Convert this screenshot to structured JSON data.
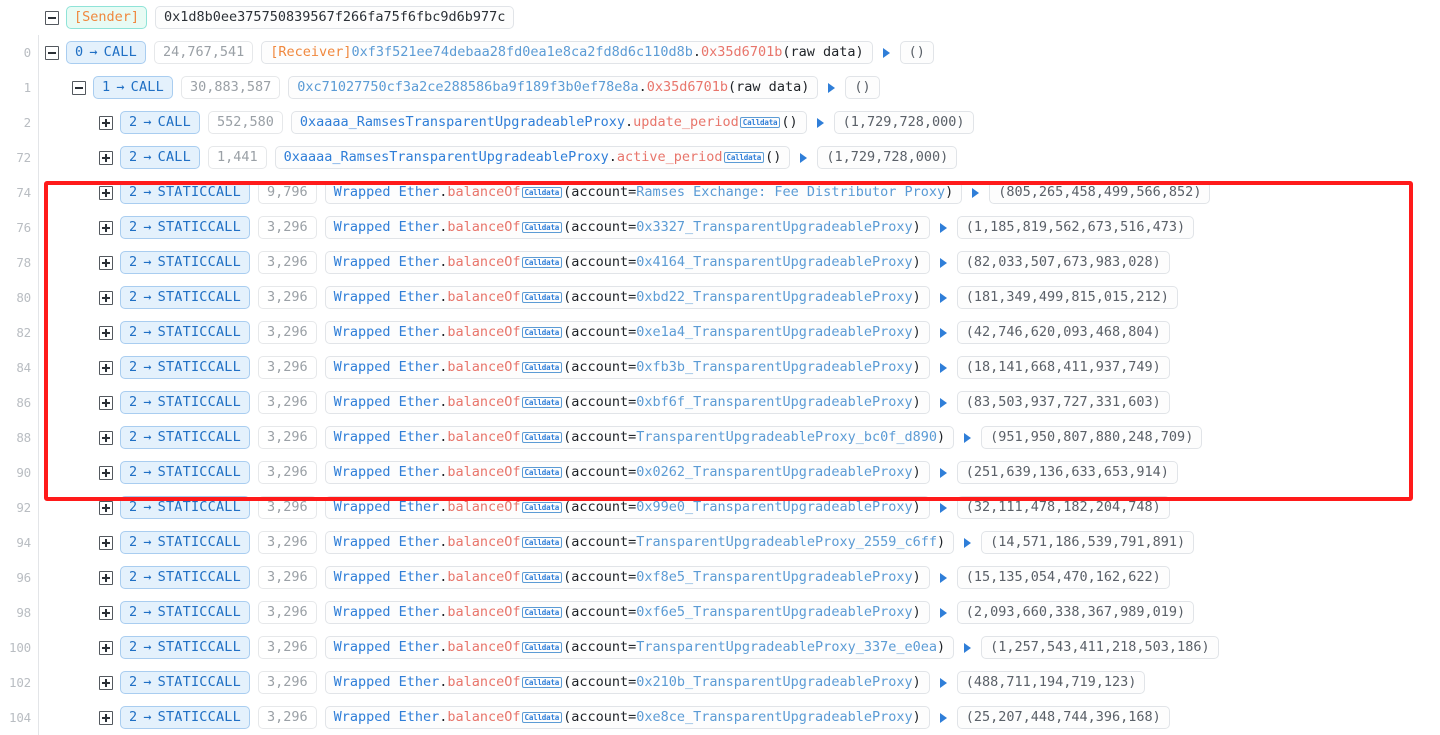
{
  "meta": {
    "accent_blue": "#2f7ed8",
    "accent_orange": "#f0883e",
    "accent_red": "#e8756b",
    "highlight_color": "#ff1a1a",
    "calldata_badge": "Calldata"
  },
  "sender_row": {
    "label": "[Sender]",
    "address": "0x1d8b0ee375750839567f266fa75f6fbc9d6b977c"
  },
  "rows": [
    {
      "line": "0",
      "indent": 0,
      "toggle": "minus",
      "op_index": "0",
      "op_type": "CALL",
      "gas": "24,767,541",
      "call": {
        "prefix_label": "[Receiver]",
        "target": "0xf3f521ee74debaa28fd0ea1e8ca2fd8d6c110d8b",
        "selector": "0x35d6701b",
        "args": "(raw data)"
      },
      "return_value": "()"
    },
    {
      "line": "1",
      "indent": 1,
      "toggle": "minus",
      "op_index": "1",
      "op_type": "CALL",
      "gas": "30,883,587",
      "call": {
        "prefix_label": "",
        "target": "0xc71027750cf3a2ce288586ba9f189f3b0ef78e8a",
        "selector": "0x35d6701b",
        "args": "(raw data)"
      },
      "return_value": "()"
    },
    {
      "line": "2",
      "indent": 2,
      "toggle": "plus",
      "op_index": "2",
      "op_type": "CALL",
      "gas": "552,580",
      "call": {
        "contract": "0xaaaa_RamsesTransparentUpgradeableProxy",
        "method": "update_period",
        "badge": "Calldata",
        "args": "()"
      },
      "return_value": "(1,729,728,000)"
    },
    {
      "line": "72",
      "indent": 2,
      "toggle": "plus",
      "op_index": "2",
      "op_type": "CALL",
      "gas": "1,441",
      "call": {
        "contract": "0xaaaa_RamsesTransparentUpgradeableProxy",
        "method": "active_period",
        "badge": "Calldata",
        "args": "()"
      },
      "return_value": "(1,729,728,000)"
    },
    {
      "line": "74",
      "indent": 2,
      "toggle": "plus",
      "op_index": "2",
      "op_type": "STATICCALL",
      "gas": "9,796",
      "call": {
        "contract": "Wrapped Ether",
        "method": "balanceOf",
        "badge": "Calldata",
        "arg_name": "account=",
        "arg_value": "Ramses Exchange: Fee Distributor Proxy"
      },
      "return_value": "(805,265,458,499,566,852)"
    },
    {
      "line": "76",
      "indent": 2,
      "toggle": "plus",
      "op_index": "2",
      "op_type": "STATICCALL",
      "gas": "3,296",
      "call": {
        "contract": "Wrapped Ether",
        "method": "balanceOf",
        "badge": "Calldata",
        "arg_name": "account=",
        "arg_value": "0x3327_TransparentUpgradeableProxy"
      },
      "return_value": "(1,185,819,562,673,516,473)"
    },
    {
      "line": "78",
      "indent": 2,
      "toggle": "plus",
      "op_index": "2",
      "op_type": "STATICCALL",
      "gas": "3,296",
      "call": {
        "contract": "Wrapped Ether",
        "method": "balanceOf",
        "badge": "Calldata",
        "arg_name": "account=",
        "arg_value": "0x4164_TransparentUpgradeableProxy"
      },
      "return_value": "(82,033,507,673,983,028)"
    },
    {
      "line": "80",
      "indent": 2,
      "toggle": "plus",
      "op_index": "2",
      "op_type": "STATICCALL",
      "gas": "3,296",
      "call": {
        "contract": "Wrapped Ether",
        "method": "balanceOf",
        "badge": "Calldata",
        "arg_name": "account=",
        "arg_value": "0xbd22_TransparentUpgradeableProxy"
      },
      "return_value": "(181,349,499,815,015,212)"
    },
    {
      "line": "82",
      "indent": 2,
      "toggle": "plus",
      "op_index": "2",
      "op_type": "STATICCALL",
      "gas": "3,296",
      "call": {
        "contract": "Wrapped Ether",
        "method": "balanceOf",
        "badge": "Calldata",
        "arg_name": "account=",
        "arg_value": "0xe1a4_TransparentUpgradeableProxy"
      },
      "return_value": "(42,746,620,093,468,804)"
    },
    {
      "line": "84",
      "indent": 2,
      "toggle": "plus",
      "op_index": "2",
      "op_type": "STATICCALL",
      "gas": "3,296",
      "call": {
        "contract": "Wrapped Ether",
        "method": "balanceOf",
        "badge": "Calldata",
        "arg_name": "account=",
        "arg_value": "0xfb3b_TransparentUpgradeableProxy"
      },
      "return_value": "(18,141,668,411,937,749)"
    },
    {
      "line": "86",
      "indent": 2,
      "toggle": "plus",
      "op_index": "2",
      "op_type": "STATICCALL",
      "gas": "3,296",
      "call": {
        "contract": "Wrapped Ether",
        "method": "balanceOf",
        "badge": "Calldata",
        "arg_name": "account=",
        "arg_value": "0xbf6f_TransparentUpgradeableProxy"
      },
      "return_value": "(83,503,937,727,331,603)"
    },
    {
      "line": "88",
      "indent": 2,
      "toggle": "plus",
      "op_index": "2",
      "op_type": "STATICCALL",
      "gas": "3,296",
      "call": {
        "contract": "Wrapped Ether",
        "method": "balanceOf",
        "badge": "Calldata",
        "arg_name": "account=",
        "arg_value": "TransparentUpgradeableProxy_bc0f_d890"
      },
      "return_value": "(951,950,807,880,248,709)"
    },
    {
      "line": "90",
      "indent": 2,
      "toggle": "plus",
      "op_index": "2",
      "op_type": "STATICCALL",
      "gas": "3,296",
      "call": {
        "contract": "Wrapped Ether",
        "method": "balanceOf",
        "badge": "Calldata",
        "arg_name": "account=",
        "arg_value": "0x0262_TransparentUpgradeableProxy"
      },
      "return_value": "(251,639,136,633,653,914)"
    },
    {
      "line": "92",
      "indent": 2,
      "toggle": "plus",
      "op_index": "2",
      "op_type": "STATICCALL",
      "gas": "3,296",
      "call": {
        "contract": "Wrapped Ether",
        "method": "balanceOf",
        "badge": "Calldata",
        "arg_name": "account=",
        "arg_value": "0x99e0_TransparentUpgradeableProxy"
      },
      "return_value": "(32,111,478,182,204,748)"
    },
    {
      "line": "94",
      "indent": 2,
      "toggle": "plus",
      "op_index": "2",
      "op_type": "STATICCALL",
      "gas": "3,296",
      "call": {
        "contract": "Wrapped Ether",
        "method": "balanceOf",
        "badge": "Calldata",
        "arg_name": "account=",
        "arg_value": "TransparentUpgradeableProxy_2559_c6ff"
      },
      "return_value": "(14,571,186,539,791,891)"
    },
    {
      "line": "96",
      "indent": 2,
      "toggle": "plus",
      "op_index": "2",
      "op_type": "STATICCALL",
      "gas": "3,296",
      "call": {
        "contract": "Wrapped Ether",
        "method": "balanceOf",
        "badge": "Calldata",
        "arg_name": "account=",
        "arg_value": "0xf8e5_TransparentUpgradeableProxy"
      },
      "return_value": "(15,135,054,470,162,622)"
    },
    {
      "line": "98",
      "indent": 2,
      "toggle": "plus",
      "op_index": "2",
      "op_type": "STATICCALL",
      "gas": "3,296",
      "call": {
        "contract": "Wrapped Ether",
        "method": "balanceOf",
        "badge": "Calldata",
        "arg_name": "account=",
        "arg_value": "0xf6e5_TransparentUpgradeableProxy"
      },
      "return_value": "(2,093,660,338,367,989,019)"
    },
    {
      "line": "100",
      "indent": 2,
      "toggle": "plus",
      "op_index": "2",
      "op_type": "STATICCALL",
      "gas": "3,296",
      "call": {
        "contract": "Wrapped Ether",
        "method": "balanceOf",
        "badge": "Calldata",
        "arg_name": "account=",
        "arg_value": "TransparentUpgradeableProxy_337e_e0ea"
      },
      "return_value": "(1,257,543,411,218,503,186)"
    },
    {
      "line": "102",
      "indent": 2,
      "toggle": "plus",
      "op_index": "2",
      "op_type": "STATICCALL",
      "gas": "3,296",
      "call": {
        "contract": "Wrapped Ether",
        "method": "balanceOf",
        "badge": "Calldata",
        "arg_name": "account=",
        "arg_value": "0x210b_TransparentUpgradeableProxy"
      },
      "return_value": "(488,711,194,719,123)"
    },
    {
      "line": "104",
      "indent": 2,
      "toggle": "plus",
      "op_index": "2",
      "op_type": "STATICCALL",
      "gas": "3,296",
      "call": {
        "contract": "Wrapped Ether",
        "method": "balanceOf",
        "badge": "Calldata",
        "arg_name": "account=",
        "arg_value": "0xe8ce_TransparentUpgradeableProxy"
      },
      "return_value": "(25,207,448,744,396,168)"
    }
  ],
  "highlight": {
    "first_line": "74",
    "last_line": "90"
  }
}
